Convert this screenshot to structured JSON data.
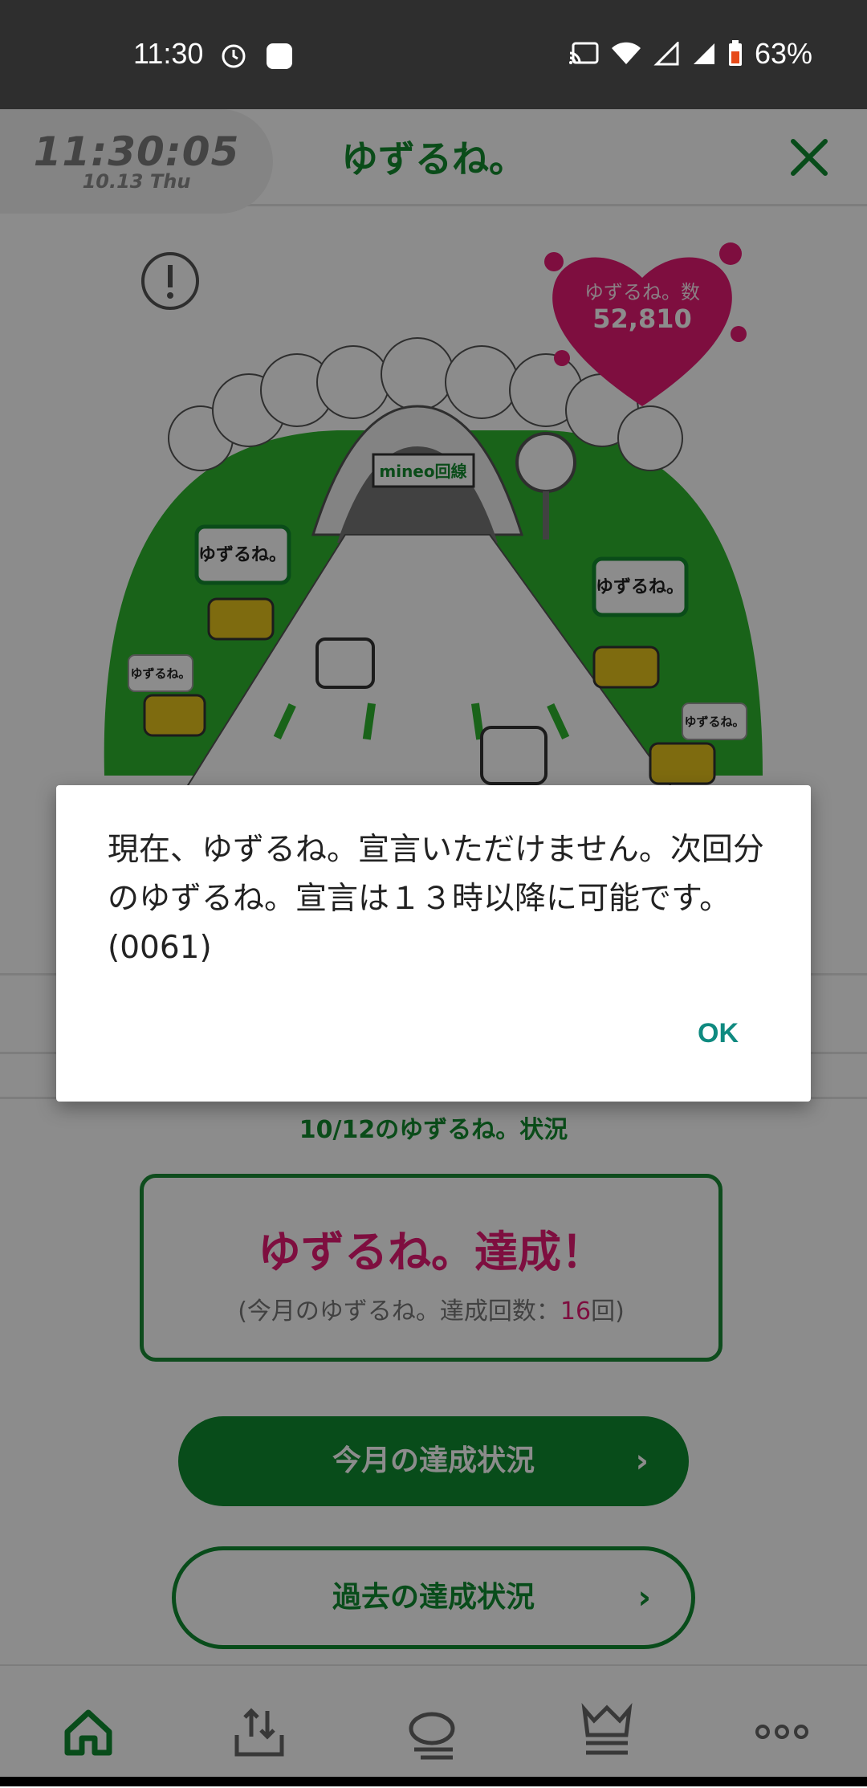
{
  "status_bar": {
    "time": "11:30",
    "battery": "63%"
  },
  "clock_widget": {
    "time": "11:30:05",
    "date": "10.13 Thu"
  },
  "header": {
    "title": "ゆずるね。"
  },
  "counter": {
    "label": "ゆずるね。数",
    "value": "52,810"
  },
  "illustration": {
    "sign": "mineo回線",
    "bubble_text": "ゆずるね。"
  },
  "status": {
    "date_label": "10/12のゆずるね。状況",
    "achievement_title": "ゆずるね。達成！",
    "sub_prefix": "(今月のゆずるね。達成回数：",
    "sub_count": "16",
    "sub_suffix": "回)"
  },
  "buttons": {
    "month": "今月の達成状況",
    "past": "過去の達成状況"
  },
  "dialog": {
    "message": "現在、ゆずるね。宣言いただけません。次回分のゆずるね。宣言は１３時以降に可能です。(0061)",
    "ok": "OK"
  },
  "colors": {
    "brand_green": "#0f8a30",
    "accent_pink": "#e51b74",
    "dialog_button": "#0f8a80"
  },
  "nav_icons": [
    "home-icon",
    "upload-icon",
    "chat-icon",
    "crown-icon",
    "more-icon"
  ]
}
